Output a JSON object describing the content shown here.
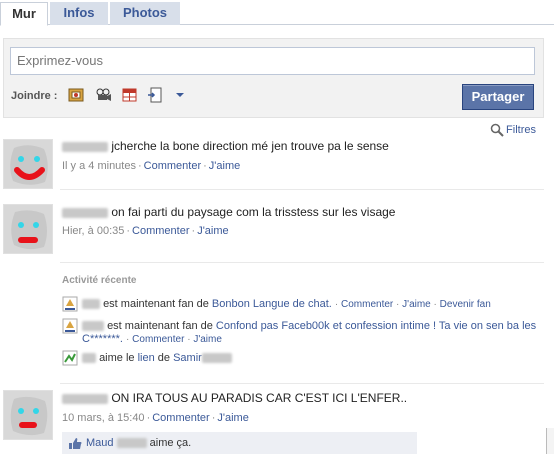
{
  "tabs": [
    {
      "label": "Mur"
    },
    {
      "label": "Infos"
    },
    {
      "label": "Photos"
    }
  ],
  "composer": {
    "placeholder": "Exprimez-vous",
    "attach_label": "Joindre :",
    "share_label": "Partager",
    "attach_icons": [
      "photo-icon",
      "video-icon",
      "event-icon",
      "link-icon",
      "more-dropdown-icon"
    ]
  },
  "filters": {
    "label": "Filtres"
  },
  "posts": [
    {
      "text": "jcherche la bone direction mé jen trouve pa le sense",
      "time": "Il y a 4 minutes",
      "comment": "Commenter",
      "like": "J'aime"
    },
    {
      "text": "on fai parti du paysage com la trisstess sur les visage",
      "time": "Hier, à 00:35",
      "comment": "Commenter",
      "like": "J'aime"
    },
    {
      "text": "ON IRA TOUS AU PARADIS CAR C'EST ICI L'ENFER..",
      "time": "10 mars, à 15:40",
      "comment": "Commenter",
      "like": "J'aime"
    }
  ],
  "activity": {
    "heading": "Activité récente",
    "items": [
      {
        "prefix": "est maintenant fan de",
        "link": "Bonbon Langue de chat.",
        "actions": [
          "Commenter",
          "J'aime",
          "Devenir fan"
        ]
      },
      {
        "prefix": "est maintenant fan de",
        "link": "Confond pas Faceb00k et confession intime ! Ta vie on sen ba les",
        "link2": "C*******.",
        "actions": [
          "Commenter",
          "J'aime"
        ]
      },
      {
        "prefix": "aime le",
        "link": "lien",
        "middle": "de",
        "link2": "Samir"
      }
    ]
  },
  "like_bar": {
    "name": "Maud",
    "suffix": "aime ça."
  },
  "colors": {
    "link": "#3b5998",
    "share_button": "#5b74a8",
    "tab_inactive_bg": "#d8dfea"
  }
}
